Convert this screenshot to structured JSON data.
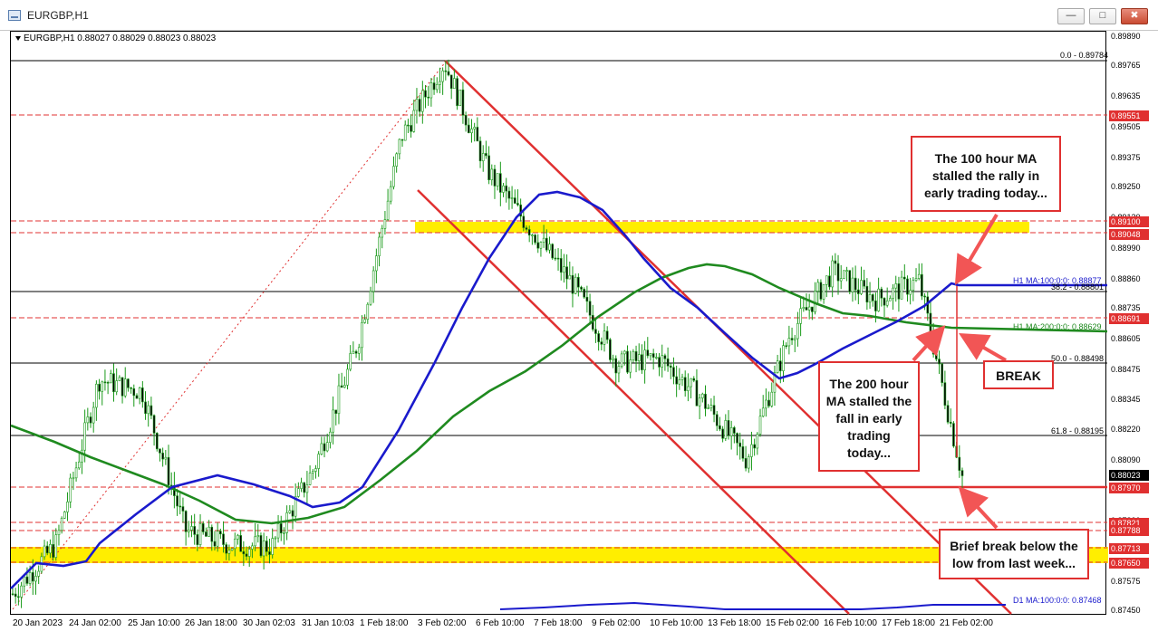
{
  "window": {
    "title": "EURGBP,H1",
    "buttons": [
      "—",
      "□",
      "✖"
    ]
  },
  "symbol_info": "EURGBP,H1  0.88027 0.88029 0.88023 0.88023",
  "price_axis": {
    "labels": [
      "0.89890",
      "0.89765",
      "0.89635",
      "0.89505",
      "0.89375",
      "0.89250",
      "0.89120",
      "0.88990",
      "0.88860",
      "0.88735",
      "0.88605",
      "0.88475",
      "0.88345",
      "0.88220",
      "0.88090",
      "0.87960",
      "0.87830",
      "0.87700",
      "0.87575",
      "0.87450"
    ],
    "boxed": [
      {
        "text": "0.89551",
        "kind": "level"
      },
      {
        "text": "0.89100",
        "kind": "level"
      },
      {
        "text": "0.89048",
        "kind": "level"
      },
      {
        "text": "0.88691",
        "kind": "level"
      },
      {
        "text": "0.88023",
        "kind": "current"
      },
      {
        "text": "0.87970",
        "kind": "level"
      },
      {
        "text": "0.87821",
        "kind": "level"
      },
      {
        "text": "0.87788",
        "kind": "level"
      },
      {
        "text": "0.87713",
        "kind": "level"
      },
      {
        "text": "0.87650",
        "kind": "level"
      }
    ]
  },
  "time_axis": [
    "20 Jan 2023",
    "24 Jan 02:00",
    "25 Jan 10:00",
    "26 Jan 18:00",
    "30 Jan 02:03",
    "31 Jan 10:03",
    "1 Feb 18:00",
    "3 Feb 02:00",
    "6 Feb 10:00",
    "7 Feb 18:00",
    "9 Feb 02:00",
    "10 Feb 10:00",
    "13 Feb 18:00",
    "15 Feb 02:00",
    "16 Feb 10:00",
    "17 Feb 18:00",
    "21 Feb 02:00"
  ],
  "line_tags": {
    "fib_0": "0.0 - 0.89784",
    "fib_38": "38.2 - 0.88801",
    "fib_50": "50.0 - 0.88498",
    "fib_61": "61.8 - 0.88195",
    "ma100": "H1 MA:100:0:0: 0.88877",
    "ma200": "H1 MA:200:0:0: 0.88629",
    "d1ma": "D1 MA:100:0:0: 0.87468"
  },
  "callouts": {
    "ma100": "The 100 hour MA stalled the rally in early trading today...",
    "ma200": "The 200 hour MA stalled the fall in early trading today...",
    "break": "BREAK",
    "brief": "Brief break below the low from last week..."
  },
  "colors": {
    "ma100": "#1a1acc",
    "ma200": "#1f8a1f",
    "annotation": "#e03030",
    "zone": "#ffee00",
    "candle": "#1a9a1a"
  },
  "chart_data": {
    "type": "candlestick",
    "symbol": "EURGBP",
    "timeframe": "H1",
    "ylim": [
      0.8745,
      0.8989
    ],
    "x_start": "20 Jan 2023",
    "x_end": "21 Feb 2023",
    "price_path": [
      [
        "20 Jan 2023",
        0.8752
      ],
      [
        "23 Jan 2023",
        0.8773
      ],
      [
        "24 Jan 2023",
        0.8843
      ],
      [
        "25 Jan 2023",
        0.8838
      ],
      [
        "26 Jan 2023",
        0.8779
      ],
      [
        "27 Jan 2023",
        0.8773
      ],
      [
        "30 Jan 2023",
        0.8772
      ],
      [
        "31 Jan 2023",
        0.8806
      ],
      [
        "1 Feb 2023",
        0.8859
      ],
      [
        "2 Feb 2023",
        0.8946
      ],
      [
        "3 Feb 2023",
        0.8978
      ],
      [
        "6 Feb 2023",
        0.8932
      ],
      [
        "7 Feb 2023",
        0.8907
      ],
      [
        "8 Feb 2023",
        0.8883
      ],
      [
        "9 Feb 2023",
        0.885
      ],
      [
        "10 Feb 2023",
        0.8852
      ],
      [
        "13 Feb 2023",
        0.8834
      ],
      [
        "14 Feb 2023",
        0.8809
      ],
      [
        "15 Feb 2023",
        0.8862
      ],
      [
        "16 Feb 2023",
        0.8889
      ],
      [
        "17 Feb 2023",
        0.8877
      ],
      [
        "20 Feb 2023",
        0.8885
      ],
      [
        "21 Feb 2023",
        0.8802
      ]
    ],
    "last_price": 0.88023,
    "ma100_last": 0.88877,
    "ma200_last": 0.88629,
    "d1_ma100": 0.87468,
    "fibonacci": [
      {
        "level": "0.0",
        "price": 0.89784
      },
      {
        "level": "38.2",
        "price": 0.88801
      },
      {
        "level": "50.0",
        "price": 0.88498
      },
      {
        "level": "61.8",
        "price": 0.88195
      }
    ],
    "horizontal_levels": [
      0.89551,
      0.891,
      0.89048,
      0.88691,
      0.8797,
      0.87821,
      0.87788,
      0.87713,
      0.8765
    ],
    "zones": [
      {
        "from": 0.89048,
        "to": 0.891
      },
      {
        "from": 0.8765,
        "to": 0.87713
      }
    ]
  }
}
